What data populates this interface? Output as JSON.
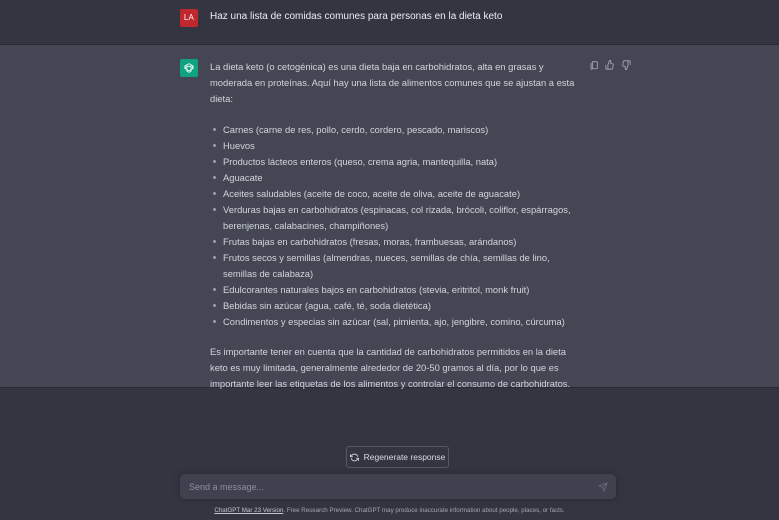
{
  "user_message": {
    "avatar_initials": "LA",
    "text": "Haz una lista de comidas comunes para personas en la dieta keto"
  },
  "assistant_message": {
    "intro": "La dieta keto (o cetogénica) es una dieta baja en carbohidratos, alta en grasas y moderada en proteínas. Aquí hay una lista de alimentos comunes que se ajustan a esta dieta:",
    "items": [
      "Carnes (carne de res, pollo, cerdo, cordero, pescado, mariscos)",
      "Huevos",
      "Productos lácteos enteros (queso, crema agria, mantequilla, nata)",
      "Aguacate",
      "Aceites saludables (aceite de coco, aceite de oliva, aceite de aguacate)",
      "Verduras bajas en carbohidratos (espinacas, col rizada, brócoli, coliflor, espárragos, berenjenas, calabacines, champiñones)",
      "Frutas bajas en carbohidratos (fresas, moras, frambuesas, arándanos)",
      "Frutos secos y semillas (almendras, nueces, semillas de chía, semillas de lino, semillas de calabaza)",
      "Edulcorantes naturales bajos en carbohidratos (stevia, eritritol, monk fruit)",
      "Bebidas sin azúcar (agua, café, té, soda dietética)",
      "Condimentos y especias sin azúcar (sal, pimienta, ajo, jengibre, comino, cúrcuma)"
    ],
    "outro": "Es importante tener en cuenta que la cantidad de carbohidratos permitidos en la dieta keto es muy limitada, generalmente alrededor de 20-50 gramos al día, por lo que es importante leer las etiquetas de los alimentos y controlar el consumo de carbohidratos.",
    "actions": [
      "copy-icon",
      "thumbs-up-icon",
      "thumbs-down-icon"
    ]
  },
  "regenerate": {
    "label": "Regenerate response",
    "icon": "refresh-icon"
  },
  "composer": {
    "placeholder": "Send a message...",
    "value": "",
    "send_icon": "send-icon"
  },
  "footer": {
    "version_link": "ChatGPT Mar 23 Version",
    "disclaimer": ". Free Research Preview. ChatGPT may produce inaccurate information about people, places, or facts."
  },
  "colors": {
    "background": "#343541",
    "assistant_background": "#444654",
    "user_avatar": "#c1282d",
    "assistant_avatar": "#10a37f",
    "input_background": "#40414f"
  }
}
